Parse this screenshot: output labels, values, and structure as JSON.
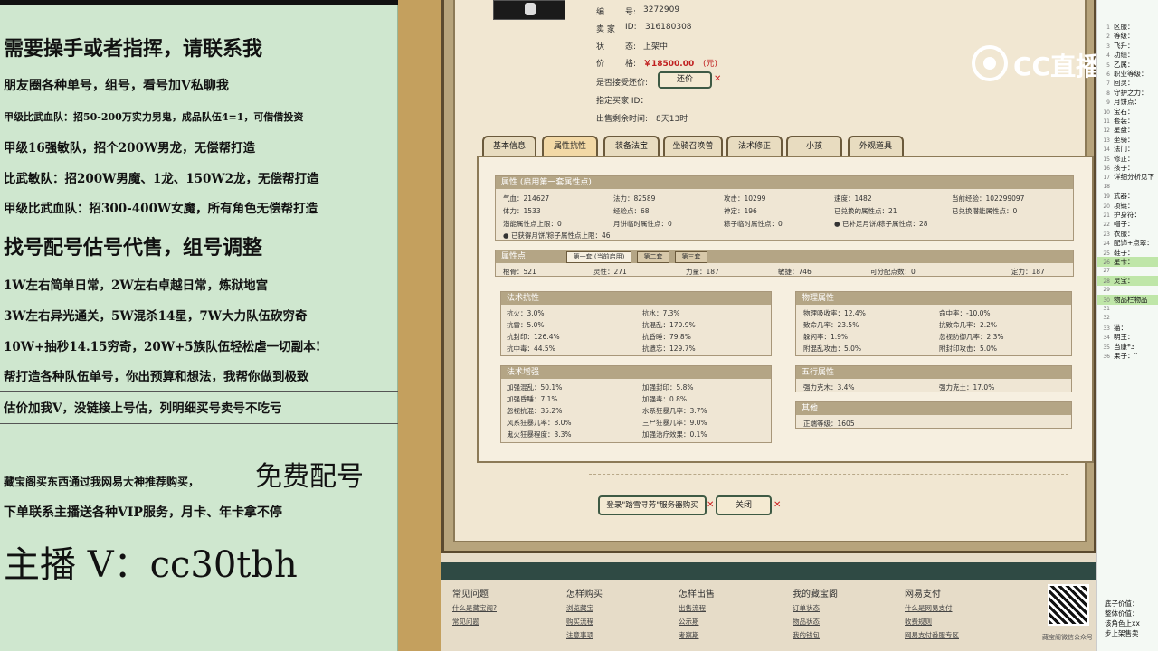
{
  "left": {
    "lines": [
      "需要操手或者指挥，请联系我",
      "朋友圈各种单号，组号，看号加V私聊我",
      "甲级比武血队：招50-200万实力男鬼，成品队伍4=1，可借借投资",
      "甲级16强敏队，招个200W男龙，无偿帮打造",
      "比武敏队：招200W男魔、1龙、150W2龙，无偿帮打造",
      "甲级比武血队：招300-400W女魔，所有角色无偿帮打造",
      "找号配号估号代售，组号调整",
      "1W左右简单日常，2W左右卓越日常，炼狱地宫",
      "3W左右异光通关，5W混杀14星，7W大力队伍砍穷奇",
      "10W+抽秒14.15穷奇，20W+5族队伍轻松虐一切副本!",
      "帮打造各种队伍单号，你出预算和想法，我帮你做到极致",
      "估价加我V，没链接上号估，列明细买号卖号不吃亏",
      "藏宝阁买东西通过我网易大神推荐购买，",
      "免费配号",
      "下单联系主播送各种VIP服务，月卡、年卡拿不停",
      "主播 V：cc30tbh"
    ]
  },
  "item": {
    "bian_label": "编",
    "hao_label": "号:",
    "number": "3272909",
    "seller_label": "卖 家",
    "id_label": "ID:",
    "seller_id": "316180308",
    "status_label": "状",
    "status_label2": "态:",
    "status": "上架中",
    "price_label": "价",
    "price_label2": "格:",
    "price": "￥18500.00",
    "price_unit": "(元)",
    "bargain_label": "是否接受还价:",
    "bargain_btn": "还价",
    "buyer_label": "指定买家 ID：",
    "remain_label": "出售剩余时间:",
    "remain": "8天13时"
  },
  "tabs": [
    "基本信息",
    "属性抗性",
    "装备法宝",
    "坐骑召唤兽",
    "法术修正",
    "小孩",
    "外观道具"
  ],
  "attr": {
    "head": "属性 (启用第一套属性点)",
    "row1": [
      "气血：214627",
      "法力：82589",
      "攻击：10299",
      "速度：1482",
      "当前经验：102299097"
    ],
    "row2": [
      "体力：1533",
      "经验点：68",
      "神定：196",
      "已兑换的属性点：21",
      "已兑换潜能属性点：0"
    ],
    "row3": [
      "潜能属性点上限：0",
      "月饼临时属性点：0",
      "粽子临时属性点：0",
      "已补足月饼/粽子属性点：28"
    ],
    "row4": "已获得月饼/粽子属性点上限：46"
  },
  "points": {
    "head": "属性点",
    "subtabs": [
      "第一套 (当前启用)",
      "第二套",
      "第三套"
    ],
    "values": [
      "根骨：521",
      "灵性：271",
      "力量：187",
      "敏捷：746",
      "可分配点数：0",
      "定力：187"
    ]
  },
  "magic_resist": {
    "head": "法术抗性",
    "cells": [
      "抗火：3.0%",
      "抗水：7.3%",
      "抗雷：5.0%",
      "抗混乱：170.9%",
      "抗封印：126.4%",
      "抗昏睡：79.8%",
      "抗中毒：44.5%",
      "抗遗忘：129.7%"
    ]
  },
  "magic_boost": {
    "head": "法术增强",
    "cells": [
      "加强混乱：50.1%",
      "加强封印：5.8%",
      "加强昏睡：7.1%",
      "加强毒：0.8%",
      "忽视抗混：35.2%",
      "水系狂暴几率：3.7%",
      "风系狂暴几率：8.0%",
      "三尸狂暴几率：9.0%",
      "鬼火狂暴程度：3.3%",
      "加强治疗效果：0.1%"
    ]
  },
  "physical": {
    "head": "物理属性",
    "cells": [
      "物理吸收率：12.4%",
      "命中率：-10.0%",
      "致命几率：23.5%",
      "抗致命几率：2.2%",
      "躲闪率：1.9%",
      "忽视防御几率：2.3%",
      "附混乱攻击：5.0%",
      "附封印攻击：5.0%"
    ]
  },
  "five": {
    "head": "五行属性",
    "cells": [
      "强力克木：3.4%",
      "强力克土：17.0%"
    ]
  },
  "other": {
    "head": "其他",
    "cells": [
      "正端等级：1605"
    ]
  },
  "buttons": {
    "login": "登录\"踏雪寻芳\"服务器购买",
    "close": "关闭"
  },
  "footer": {
    "cols": [
      {
        "h": "常见问题",
        "l": [
          "什么是藏宝阁?",
          "常见问题"
        ]
      },
      {
        "h": "怎样购买",
        "l": [
          "浏览藏宝",
          "购买流程",
          "注意事项"
        ]
      },
      {
        "h": "怎样出售",
        "l": [
          "出售流程",
          "公示期",
          "考察期"
        ]
      },
      {
        "h": "我的藏宝阁",
        "l": [
          "订单状态",
          "物品状态",
          "我的钱包"
        ]
      },
      {
        "h": "网易支付",
        "l": [
          "什么是网易支付",
          "收费规则",
          "网易支付番服专区"
        ]
      }
    ],
    "qr_caption": "藏宝阁微信公众号"
  },
  "logo": "CC直播",
  "right": {
    "rows": [
      {
        "n": "1",
        "t": "区服："
      },
      {
        "n": "2",
        "t": "等级："
      },
      {
        "n": "3",
        "t": "飞升："
      },
      {
        "n": "4",
        "t": "功绩："
      },
      {
        "n": "5",
        "t": "乙属："
      },
      {
        "n": "6",
        "t": "职业等级："
      },
      {
        "n": "7",
        "t": "回灵："
      },
      {
        "n": "8",
        "t": "守护之力："
      },
      {
        "n": "9",
        "t": "月饼点："
      },
      {
        "n": "10",
        "t": "宝石："
      },
      {
        "n": "11",
        "t": "套装："
      },
      {
        "n": "12",
        "t": "星盘："
      },
      {
        "n": "13",
        "t": "坐骑："
      },
      {
        "n": "14",
        "t": "法门："
      },
      {
        "n": "15",
        "t": "修正："
      },
      {
        "n": "16",
        "t": "孩子："
      },
      {
        "n": "17",
        "t": "详细分析见下"
      },
      {
        "n": "18",
        "t": ""
      },
      {
        "n": "19",
        "t": "武器："
      },
      {
        "n": "20",
        "t": "项链："
      },
      {
        "n": "21",
        "t": "护身符："
      },
      {
        "n": "22",
        "t": "帽子："
      },
      {
        "n": "23",
        "t": "衣服："
      },
      {
        "n": "24",
        "t": "配饰+点翠："
      },
      {
        "n": "25",
        "t": "鞋子："
      },
      {
        "n": "26",
        "t": "星卡："
      },
      {
        "n": "27",
        "t": ""
      },
      {
        "n": "28",
        "t": "灵宝："
      },
      {
        "n": "29",
        "t": ""
      },
      {
        "n": "30",
        "t": "物品栏物品"
      },
      {
        "n": "31",
        "t": ""
      },
      {
        "n": "32",
        "t": ""
      },
      {
        "n": "33",
        "t": "猫："
      },
      {
        "n": "34",
        "t": "明王："
      },
      {
        "n": "35",
        "t": "当康*3"
      },
      {
        "n": "36",
        "t": "果子：“"
      }
    ],
    "bottom": [
      "底子价值：",
      "整体价值：",
      "该角色上xx",
      "步上架售卖"
    ]
  }
}
